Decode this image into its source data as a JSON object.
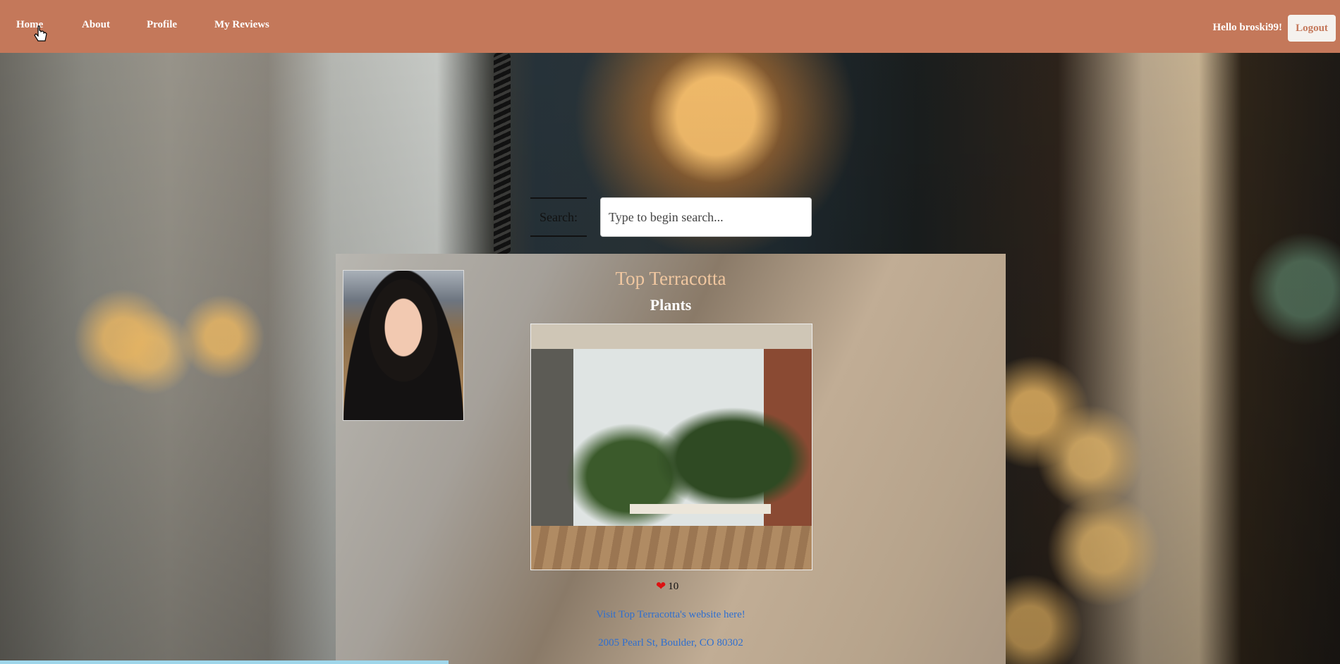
{
  "nav": {
    "items": [
      {
        "label": "Home"
      },
      {
        "label": "About"
      },
      {
        "label": "Profile"
      },
      {
        "label": "My Reviews"
      }
    ],
    "greeting": "Hello broski99!",
    "logout_label": "Logout"
  },
  "search": {
    "label": "Search:",
    "placeholder": "Type to begin search..."
  },
  "business": {
    "name": "Top Terracotta",
    "category": "Plants",
    "likes": "10",
    "website_link": "Visit Top Terracotta's website here!",
    "address": "2005 Pearl St, Boulder, CO 80302"
  },
  "colors": {
    "navbar": "#c4785a",
    "title": "#f0c7a0",
    "link": "#2f6fcf",
    "heart": "#dd1111"
  },
  "icons": {
    "heart": "heart-icon",
    "cursor": "pointer-cursor-icon"
  }
}
